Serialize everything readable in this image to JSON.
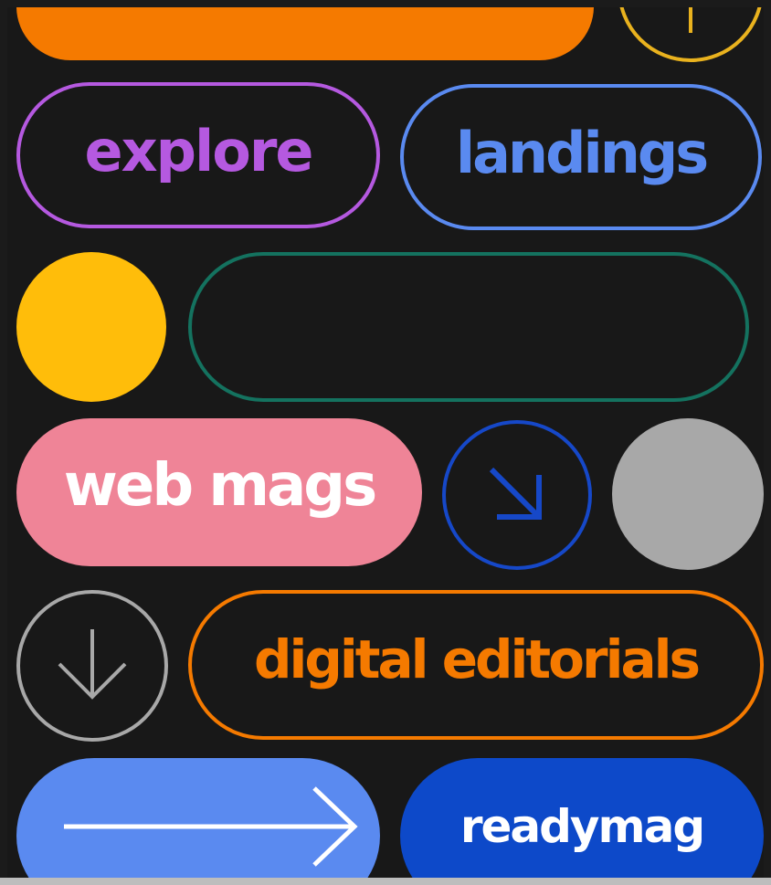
{
  "labels": {
    "explore": "explore",
    "landings": "landings",
    "web_mags": "web mags",
    "digital_editorials": "digital editorials",
    "readymag": "readymag"
  },
  "colors": {
    "background": "#181818",
    "orange": "#f57a00",
    "purple": "#b559e0",
    "blue": "#5a8af0",
    "yellow": "#ffbd0a",
    "teal": "#14725f",
    "pink": "#ef8497",
    "dark_blue": "#1648c8",
    "grey": "#a8a8a8",
    "royal_blue": "#0d49c9"
  },
  "icons": [
    "plus-icon",
    "arrow-down-right-icon",
    "arrow-down-icon",
    "arrow-right-icon"
  ]
}
